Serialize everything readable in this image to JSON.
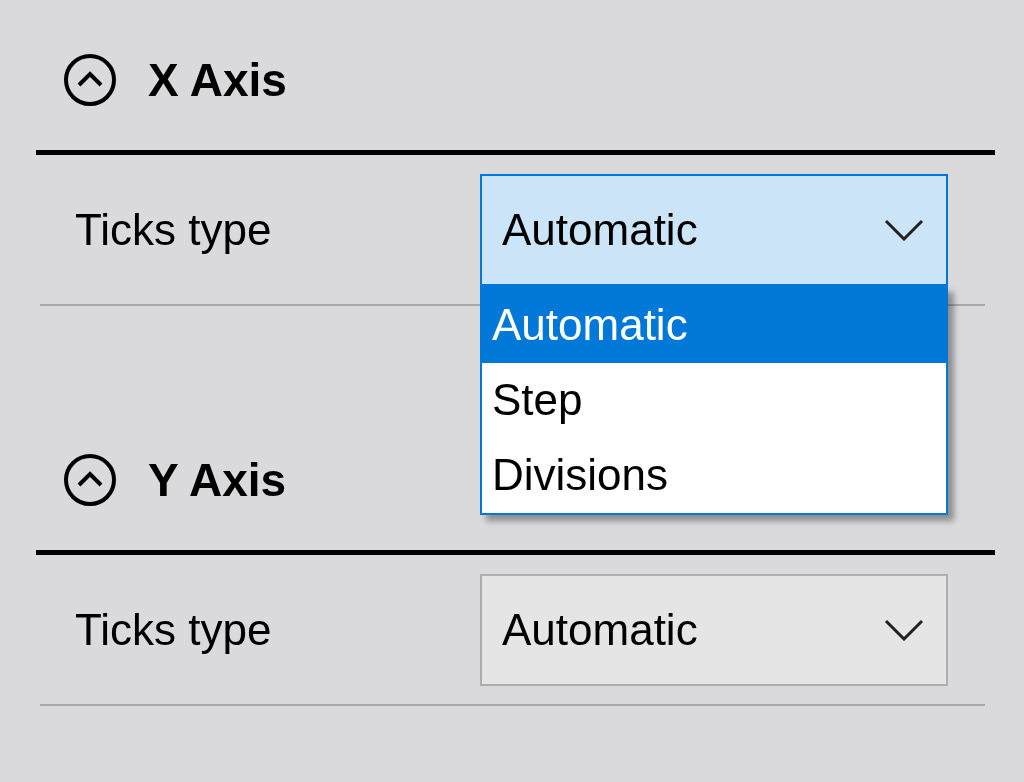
{
  "sections": [
    {
      "title": "X Axis",
      "expanded": true,
      "rows": [
        {
          "label": "Ticks type",
          "dropdown": {
            "value": "Automatic",
            "focused": true,
            "open": true
          }
        }
      ]
    },
    {
      "title": "Y Axis",
      "expanded": true,
      "rows": [
        {
          "label": "Ticks type",
          "dropdown": {
            "value": "Automatic",
            "focused": false
          }
        }
      ]
    }
  ],
  "dropdown_list": {
    "items": [
      {
        "label": "Automatic",
        "selected": true
      },
      {
        "label": "Step",
        "selected": false
      },
      {
        "label": "Divisions",
        "selected": false
      }
    ]
  }
}
